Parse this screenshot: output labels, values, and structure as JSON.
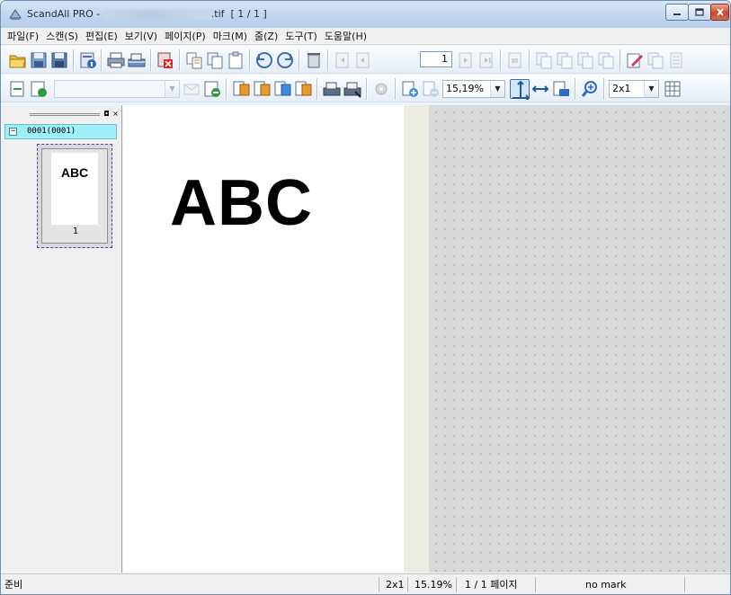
{
  "window": {
    "title_prefix": "ScandAll PRO - ",
    "title_suffix": ".tif  [ 1 / 1 ]"
  },
  "menu": [
    "파일(F)",
    "스캔(S)",
    "편집(E)",
    "보기(V)",
    "페이지(P)",
    "마크(M)",
    "줌(Z)",
    "도구(T)",
    "도움말(H)"
  ],
  "toolbar": {
    "page_number": "1",
    "zoom_value": "15,19%",
    "layout_value": "2x1"
  },
  "tree": {
    "collapse_symbol": "−",
    "node_label": "0001(0001)"
  },
  "panel": {
    "restore_symbol": "◘",
    "close_symbol": "×"
  },
  "thumbnail": {
    "text": "ABC",
    "number": "1"
  },
  "document": {
    "text": "ABC"
  },
  "status": {
    "ready": "준비",
    "layout": "2x1",
    "zoom": "15.19%",
    "pages": "1 / 1 페이지",
    "mark": "no mark"
  },
  "colors": {
    "tree_highlight": "#9ef0f8",
    "viewer_bg": "#d9d9d9",
    "close_button": "#c8482e"
  }
}
